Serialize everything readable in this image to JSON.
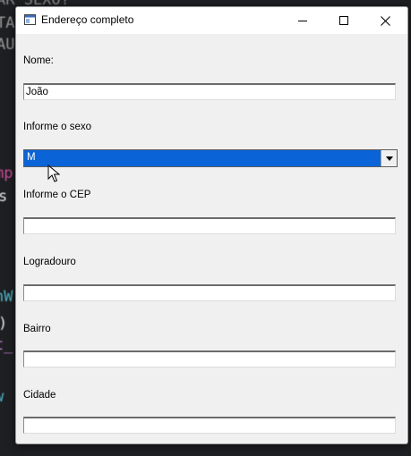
{
  "window": {
    "title": "Endereço completo",
    "minimize_icon": "minimize-icon",
    "maximize_icon": "maximize-icon",
    "close_icon": "close-icon"
  },
  "form": {
    "nome_label": "Nome:",
    "nome_value": "João",
    "sexo_label": "Informe o sexo",
    "sexo_value": "M",
    "cep_label": "Informe o CEP",
    "cep_value": "",
    "logradouro_label": "Logradouro",
    "logradouro_value": "",
    "bairro_label": "Bairro",
    "bairro_value": "",
    "cidade_label": "Cidade",
    "cidade_value": ""
  },
  "background_code": {
    "lines": [
      "AR SEXO?",
      "TA",
      "AU",
      "mp",
      "s",
      "nW",
      ")",
      "t_",
      "w"
    ]
  },
  "colors": {
    "selection": "#0a64d8",
    "window_bg": "#f0f0f0",
    "editor_bg": "#1e1f22"
  }
}
